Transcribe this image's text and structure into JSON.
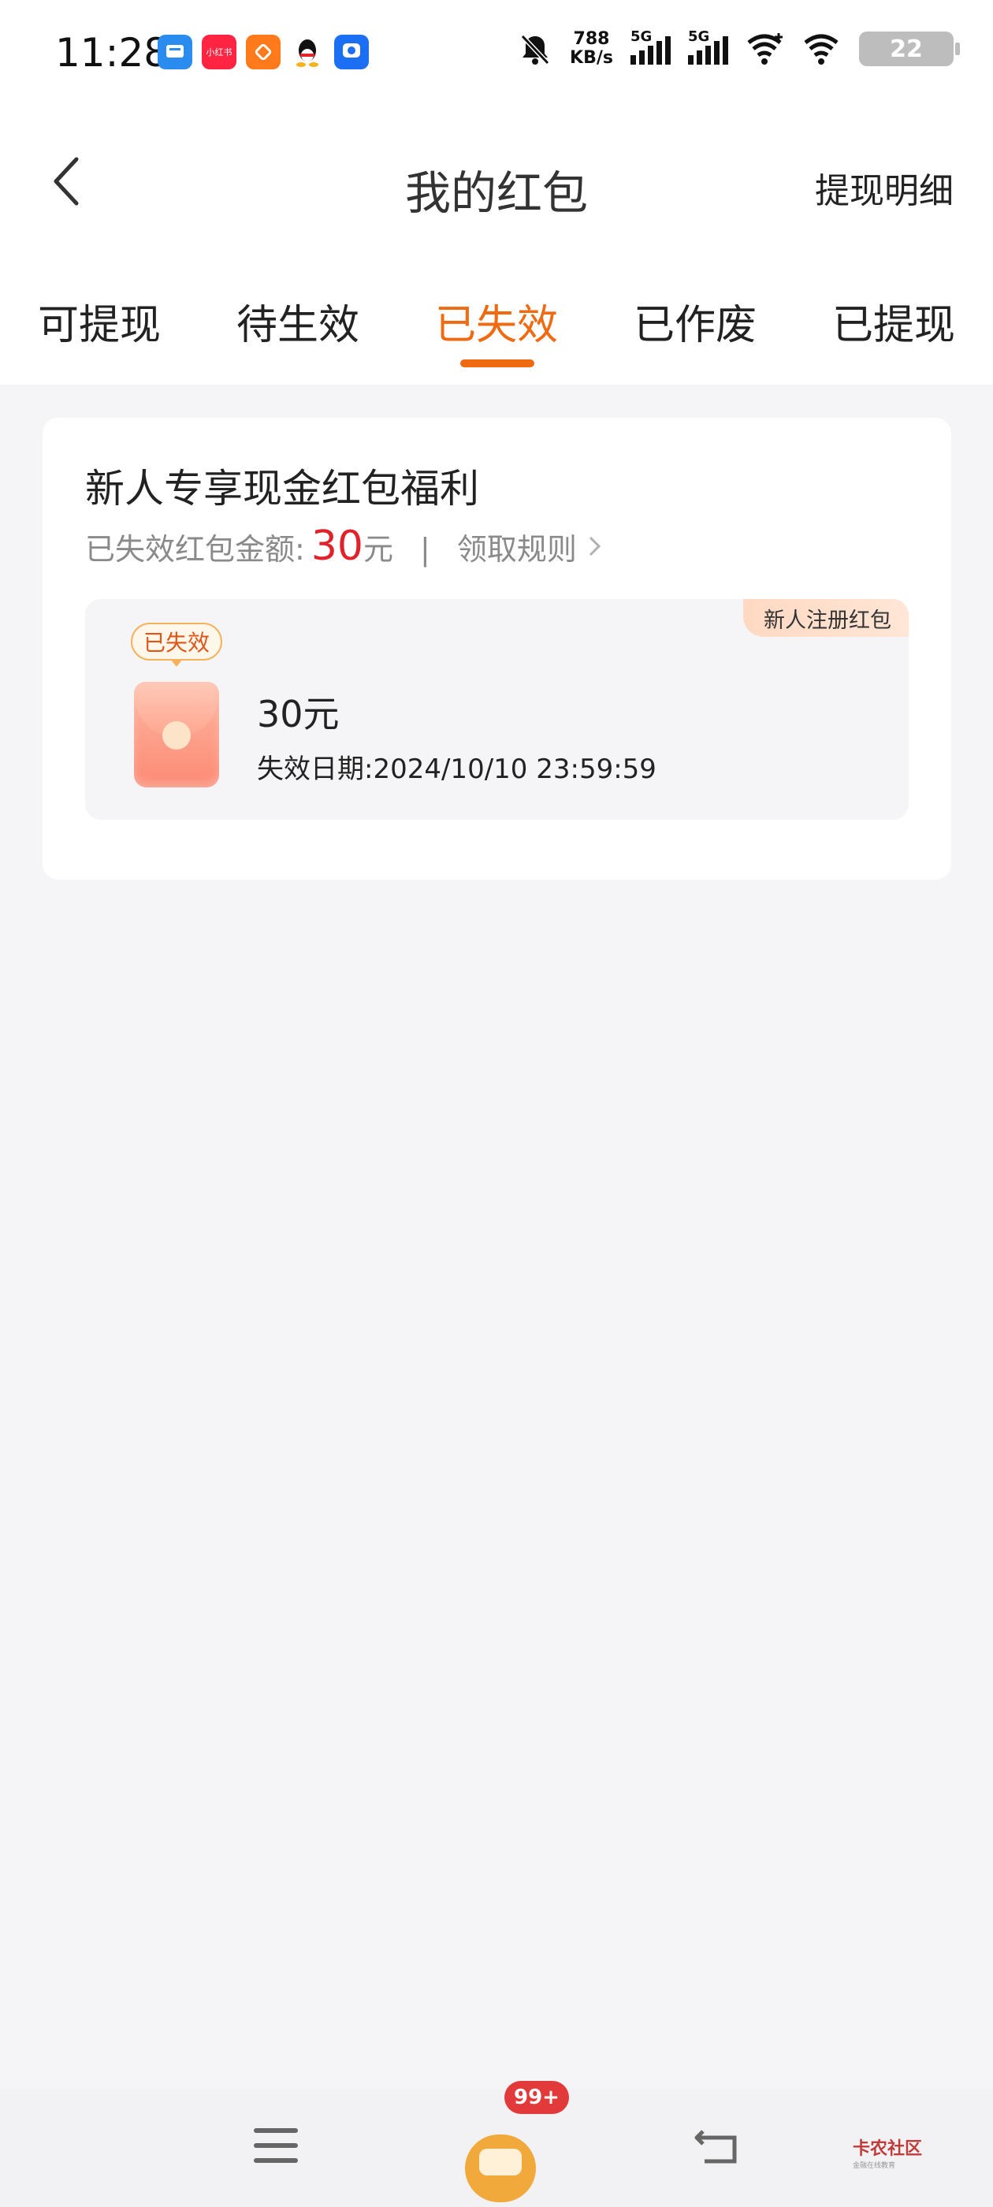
{
  "status_bar": {
    "time": "11:28",
    "app_icons": [
      {
        "name": "chat-app-icon",
        "color": "#2b8cf0",
        "label": ""
      },
      {
        "name": "xiaohongshu-app-icon",
        "color": "#ff2442",
        "label": "小红书"
      },
      {
        "name": "orange-app-icon",
        "color": "#ff7a1a",
        "label": ""
      },
      {
        "name": "qq-app-icon",
        "color": "#ffffff",
        "label": ""
      },
      {
        "name": "blue-app-icon",
        "color": "#1c6ef2",
        "label": ""
      }
    ],
    "net_speed_value": "788",
    "net_speed_unit": "KB/s",
    "signal_1_label": "5G",
    "signal_2_label": "5G",
    "battery": "22"
  },
  "header": {
    "title": "我的红包",
    "right_link": "提现明细"
  },
  "tabs": [
    {
      "label": "可提现",
      "active": false
    },
    {
      "label": "待生效",
      "active": false
    },
    {
      "label": "已失效",
      "active": true
    },
    {
      "label": "已作废",
      "active": false
    },
    {
      "label": "已提现",
      "active": false
    }
  ],
  "card": {
    "title": "新人专享现金红包福利",
    "summary_label": "已失效红包金额:",
    "summary_amount": "30",
    "summary_unit": "元",
    "separator": "|",
    "rules_link": "领取规则",
    "coupon": {
      "corner_tag": "新人注册红包",
      "status_tag": "已失效",
      "amount": "30元",
      "expiry": "失效日期:2024/10/10 23:59:59"
    }
  },
  "nav": {
    "badge": "99+",
    "watermark_title": "卡农社区",
    "watermark_sub": "金融在线教育"
  },
  "colors": {
    "accent": "#f06a12",
    "amount_red": "#e0222a",
    "background": "#f5f5f7"
  }
}
